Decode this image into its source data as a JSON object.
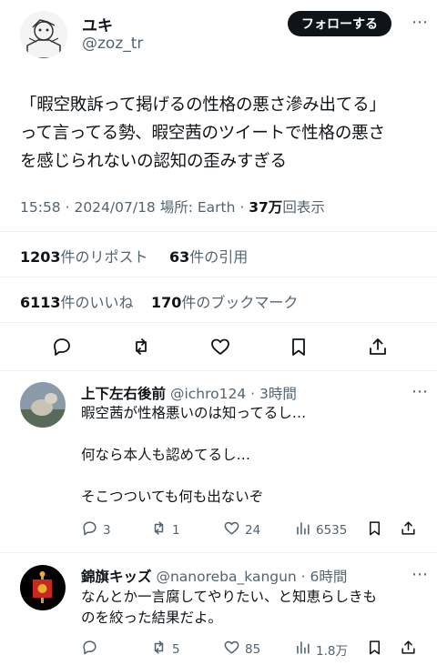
{
  "tweet": {
    "display_name": "ユキ",
    "handle": "@zoz_tr",
    "follow_label": "フォローする",
    "text_lines": [
      "「暇空敗訴って掲げるの性格の悪さ滲み出てる」",
      "って言ってる勢、暇空茜のツイートで性格の悪さ",
      "を感じられないの認知の歪みすぎる"
    ],
    "time": "15:58",
    "date": "2024/07/18",
    "location_label": "場所: Earth",
    "views_count": "37万",
    "views_label": "回表示",
    "reposts_count": "1203",
    "reposts_label": "件のリポスト",
    "quotes_count": "63",
    "quotes_label": "件の引用",
    "likes_count": "6113",
    "likes_label": "件のいいね",
    "bookmarks_count": "170",
    "bookmarks_label": "件のブックマーク"
  },
  "replies": [
    {
      "display_name": "上下左右後前",
      "handle": "@ichro124",
      "time": "3時間",
      "text_lines": [
        "暇空茜が性格悪いのは知ってるし…",
        "",
        "何なら本人も認めてるし…",
        "",
        "そこつついても何も出ないぞ"
      ],
      "reply_count": "3",
      "repost_count": "1",
      "like_count": "24",
      "view_count": "6535"
    },
    {
      "display_name": "錦旗キッズ",
      "handle": "@nanoreba_kangun",
      "time": "6時間",
      "text_lines": [
        "なんとか一言腐してやりたい、と知恵らしきも",
        "のを絞った結果だよ。"
      ],
      "reply_count": "",
      "repost_count": "5",
      "like_count": "85",
      "view_count": "1.8万"
    }
  ]
}
